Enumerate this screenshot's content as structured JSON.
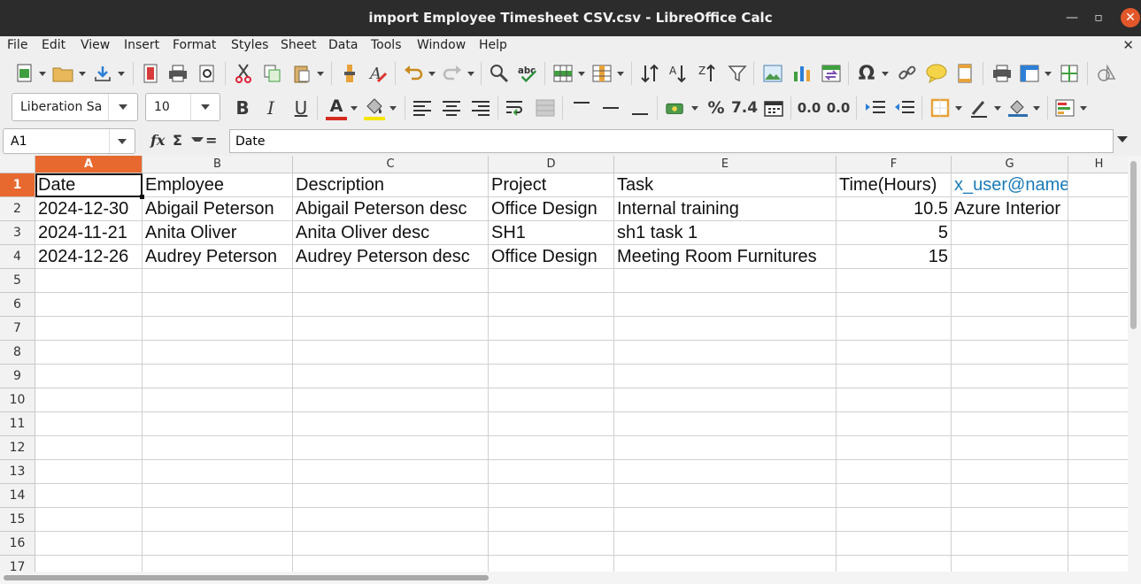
{
  "window": {
    "title": "import Employee Timesheet CSV.csv - LibreOffice Calc",
    "minimize_glyph": "—",
    "maximize_glyph": "▫",
    "close_glyph": "✕"
  },
  "menubar": {
    "items": [
      "File",
      "Edit",
      "View",
      "Insert",
      "Format",
      "Styles",
      "Sheet",
      "Data",
      "Tools",
      "Window",
      "Help"
    ],
    "doc_close_glyph": "✕"
  },
  "toolbar2": {
    "font_name": "Liberation Sa",
    "font_size": "10",
    "bold": "B",
    "italic": "I",
    "underline": "U",
    "font_color": "A",
    "percent": "%",
    "number_format": "7.4",
    "add_decimal": "0.0",
    "remove_decimal": "0.0"
  },
  "formula_bar": {
    "name_box": "A1",
    "fx": "fx",
    "sigma": "Σ",
    "equals": "=",
    "content": "Date"
  },
  "colors": {
    "accent": "#e8692f",
    "link": "#1a7bb8",
    "font_color_bar": "#d52b1e",
    "highlight_bar": "#f5e500"
  },
  "sheet": {
    "columns": [
      "A",
      "B",
      "C",
      "D",
      "E",
      "F",
      "G",
      "H"
    ],
    "selected_column": "A",
    "row_numbers": [
      "1",
      "2",
      "3",
      "4",
      "5",
      "6",
      "7",
      "8",
      "9",
      "10",
      "11",
      "12",
      "13",
      "14",
      "15",
      "16",
      "17"
    ],
    "selected_row": "1",
    "rows": [
      [
        "Date",
        "Employee",
        "Description",
        "Project",
        "Task",
        "Time(Hours)",
        "x_user@name"
      ],
      [
        "2024-12-30",
        "Abigail Peterson",
        "Abigail Peterson desc",
        "Office Design",
        "Internal training",
        "10.5",
        "Azure Interior"
      ],
      [
        "2024-11-21",
        "Anita Oliver",
        "Anita Oliver desc",
        "SH1",
        "sh1 task 1",
        "5",
        ""
      ],
      [
        "2024-12-26",
        "Audrey Peterson",
        "Audrey Peterson desc",
        "Office Design",
        "Meeting Room Furnitures",
        "15",
        ""
      ]
    ]
  }
}
